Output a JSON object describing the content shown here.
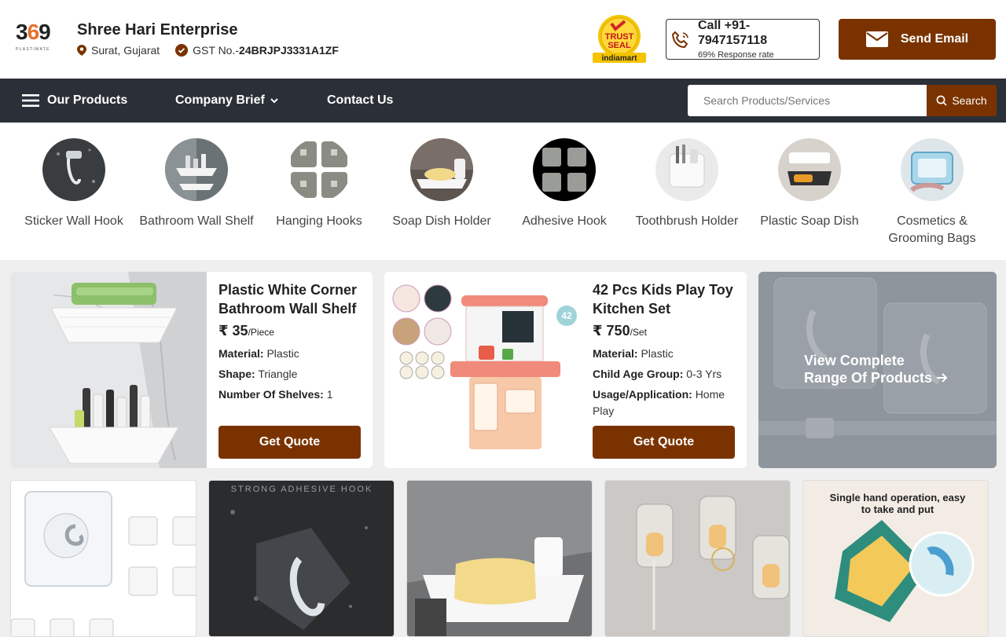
{
  "header": {
    "logo": {
      "number_left": "3",
      "number_mid": "6",
      "number_right": "9",
      "sub": "PLASTIMATE"
    },
    "company_name": "Shree Hari Enterprise",
    "location": "Surat, Gujarat",
    "gst_label": "GST No.-",
    "gst_number": "24BRJPJ3331A1ZF",
    "trust_seal": {
      "line1": "TRUST",
      "line2": "SEAL",
      "brand": "indiamart"
    },
    "call": {
      "number": "Call +91-7947157118",
      "response_rate": "69% Response rate"
    },
    "send_email_label": "Send Email"
  },
  "nav": {
    "products_label": "Our Products",
    "company_brief_label": "Company Brief",
    "contact_label": "Contact Us",
    "search_placeholder": "Search Products/Services",
    "search_button_label": "Search"
  },
  "categories": [
    {
      "label": "Sticker Wall Hook"
    },
    {
      "label": "Bathroom Wall Shelf"
    },
    {
      "label": "Hanging Hooks"
    },
    {
      "label": "Soap Dish Holder"
    },
    {
      "label": "Adhesive Hook"
    },
    {
      "label": "Toothbrush Holder"
    },
    {
      "label": "Plastic Soap Dish"
    },
    {
      "label": "Cosmetics & Grooming Bags"
    }
  ],
  "products": [
    {
      "title": "Plastic White Corner Bathroom Wall Shelf",
      "price_symbol": "₹",
      "price": "35",
      "unit": "/Piece",
      "specs": [
        {
          "key": "Material:",
          "value": "Plastic"
        },
        {
          "key": "Shape:",
          "value": "Triangle"
        },
        {
          "key": "Number Of Shelves:",
          "value": "1"
        }
      ],
      "cta": "Get Quote"
    },
    {
      "title": "42 Pcs Kids Play Toy Kitchen Set",
      "price_symbol": "₹",
      "price": "750",
      "unit": "/Set",
      "specs": [
        {
          "key": "Material:",
          "value": "Plastic"
        },
        {
          "key": "Child Age Group:",
          "value": "0-3 Yrs"
        },
        {
          "key": "Usage/Application:",
          "value": "Home Play"
        }
      ],
      "cta": "Get Quote",
      "badge": "42"
    }
  ],
  "view_all": {
    "line1": "View Complete",
    "line2": "Range Of Products"
  },
  "tiles": [
    {
      "caption": ""
    },
    {
      "caption": "STRONG ADHESIVE HOOK"
    },
    {
      "caption": ""
    },
    {
      "caption": ""
    },
    {
      "caption": "Single hand operation, easy to take and put"
    }
  ],
  "colors": {
    "brand": "#7a3300",
    "nav_bg": "#2b3038",
    "accent": "#e8702a"
  }
}
